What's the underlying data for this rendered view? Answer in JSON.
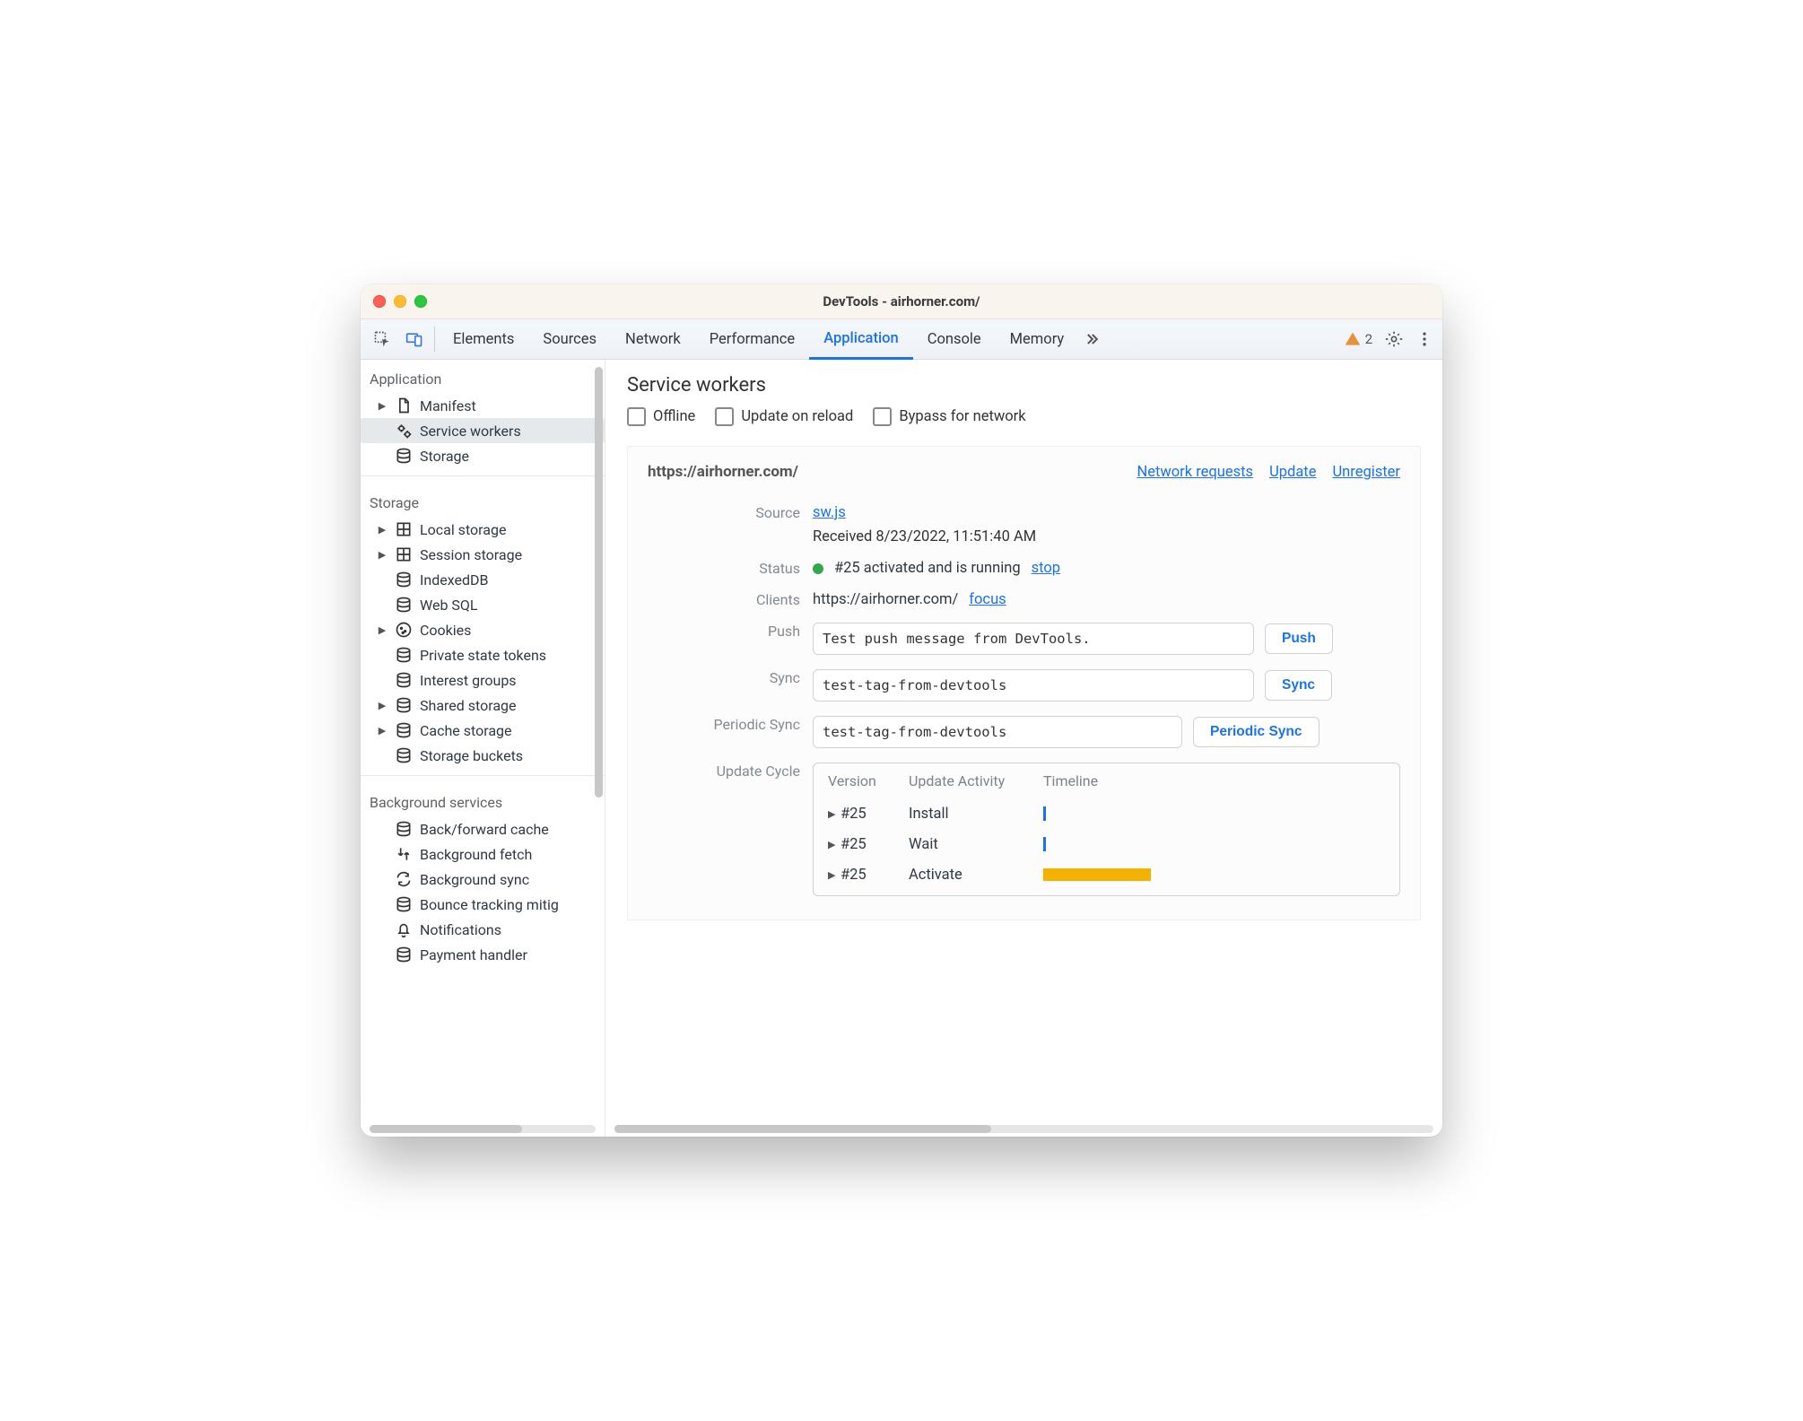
{
  "window": {
    "title": "DevTools - airhorner.com/"
  },
  "toolbar": {
    "tabs": [
      "Elements",
      "Sources",
      "Network",
      "Performance",
      "Application",
      "Console",
      "Memory"
    ],
    "active_index": 4,
    "warn_count": "2"
  },
  "sidebar": {
    "groups": [
      {
        "label": "Application",
        "items": [
          {
            "icon": "file",
            "label": "Manifest",
            "expandable": true,
            "selected": false
          },
          {
            "icon": "gears",
            "label": "Service workers",
            "expandable": false,
            "selected": true
          },
          {
            "icon": "db",
            "label": "Storage",
            "expandable": false,
            "selected": false
          }
        ]
      },
      {
        "label": "Storage",
        "items": [
          {
            "icon": "grid",
            "label": "Local storage",
            "expandable": true
          },
          {
            "icon": "grid",
            "label": "Session storage",
            "expandable": true
          },
          {
            "icon": "db",
            "label": "IndexedDB",
            "expandable": false
          },
          {
            "icon": "db",
            "label": "Web SQL",
            "expandable": false
          },
          {
            "icon": "cookie",
            "label": "Cookies",
            "expandable": true
          },
          {
            "icon": "db",
            "label": "Private state tokens",
            "expandable": false
          },
          {
            "icon": "db",
            "label": "Interest groups",
            "expandable": false
          },
          {
            "icon": "db",
            "label": "Shared storage",
            "expandable": true
          },
          {
            "icon": "db",
            "label": "Cache storage",
            "expandable": true
          },
          {
            "icon": "db",
            "label": "Storage buckets",
            "expandable": false
          }
        ]
      },
      {
        "label": "Background services",
        "items": [
          {
            "icon": "db",
            "label": "Back/forward cache",
            "expandable": false
          },
          {
            "icon": "fetch",
            "label": "Background fetch",
            "expandable": false
          },
          {
            "icon": "sync",
            "label": "Background sync",
            "expandable": false
          },
          {
            "icon": "db",
            "label": "Bounce tracking mitig",
            "expandable": false
          },
          {
            "icon": "bell",
            "label": "Notifications",
            "expandable": false
          },
          {
            "icon": "db",
            "label": "Payment handler",
            "expandable": false
          }
        ]
      }
    ]
  },
  "page": {
    "title": "Service workers",
    "checks": {
      "offline": "Offline",
      "update_on_reload": "Update on reload",
      "bypass_for_network": "Bypass for network"
    },
    "sw": {
      "origin": "https://airhorner.com/",
      "links": {
        "network": "Network requests",
        "update": "Update",
        "unregister": "Unregister"
      },
      "source_label": "Source",
      "source_file": "sw.js",
      "received": "Received 8/23/2022, 11:51:40 AM",
      "status_label": "Status",
      "status_text": "#25 activated and is running",
      "stop": "stop",
      "clients_label": "Clients",
      "clients_url": "https://airhorner.com/",
      "focus": "focus",
      "push_label": "Push",
      "push_value": "Test push message from DevTools.",
      "push_btn": "Push",
      "sync_label": "Sync",
      "sync_value": "test-tag-from-devtools",
      "sync_btn": "Sync",
      "psync_label": "Periodic Sync",
      "psync_value": "test-tag-from-devtools",
      "psync_btn": "Periodic Sync",
      "cycle_label": "Update Cycle",
      "cycle_head": {
        "version": "Version",
        "activity": "Update Activity",
        "timeline": "Timeline"
      },
      "cycle_rows": [
        {
          "version": "#25",
          "activity": "Install",
          "kind": "tick"
        },
        {
          "version": "#25",
          "activity": "Wait",
          "kind": "tick"
        },
        {
          "version": "#25",
          "activity": "Activate",
          "kind": "bar"
        }
      ]
    }
  }
}
